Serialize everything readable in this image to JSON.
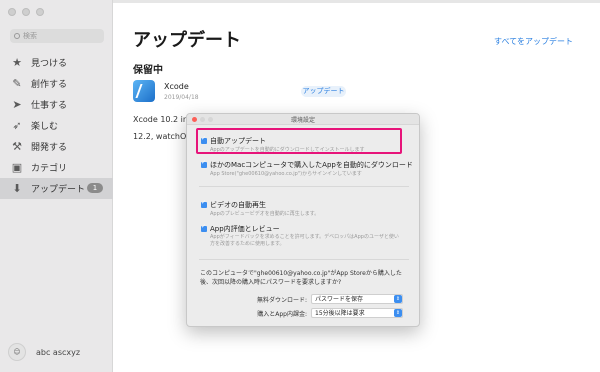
{
  "sidebar": {
    "search_placeholder": "検索",
    "items": [
      {
        "label": "見つける",
        "icon": "star-icon"
      },
      {
        "label": "創作する",
        "icon": "brush-icon"
      },
      {
        "label": "仕事する",
        "icon": "paper-plane-icon"
      },
      {
        "label": "楽しむ",
        "icon": "rocket-icon"
      },
      {
        "label": "開発する",
        "icon": "hammer-icon"
      },
      {
        "label": "カテゴリ",
        "icon": "categories-icon"
      },
      {
        "label": "アップデート",
        "icon": "download-icon",
        "badge": "1",
        "active": true
      }
    ],
    "account": {
      "name": "abc ascxyz"
    }
  },
  "main": {
    "title": "アップデート",
    "update_all": "すべてをアップデート",
    "section": "保留中",
    "app": {
      "name": "Xcode",
      "date": "2019/04/18",
      "button": "アップデート"
    },
    "release_line1": "Xcode 10.2 inc",
    "release_line2": "12.2, watchOS"
  },
  "dialog": {
    "title": "環境設定",
    "options": [
      {
        "label": "自動アップデート",
        "desc": "Appのアップデートを自動的にダウンロードしてインストールします",
        "checked": true
      },
      {
        "label": "ほかのMacコンピュータで購入したAppを自動的にダウンロード",
        "desc": "App Store(\"ghe00610@yahoo.co.jp\")からサインインしています",
        "checked": true
      },
      {
        "label": "ビデオの自動再生",
        "desc": "Appのプレビュービデオを自動的に再生します。",
        "checked": true
      },
      {
        "label": "App内評価とレビュー",
        "desc": "Appがフィードバックを求めることを許可します。デベロッパはAppのユーザと使い方を改善するために使用します。",
        "checked": true
      }
    ],
    "footnote": "このコンピュータで\"ghe00610@yahoo.co.jp\"がApp Storeから購入した後、次回以降の購入時にパスワードを要求しますか?",
    "free_download_label": "無料ダウンロード:",
    "free_download_value": "パスワードを保存",
    "purchase_label": "購入とApp内課金:",
    "purchase_value": "15分後以降は要求"
  }
}
